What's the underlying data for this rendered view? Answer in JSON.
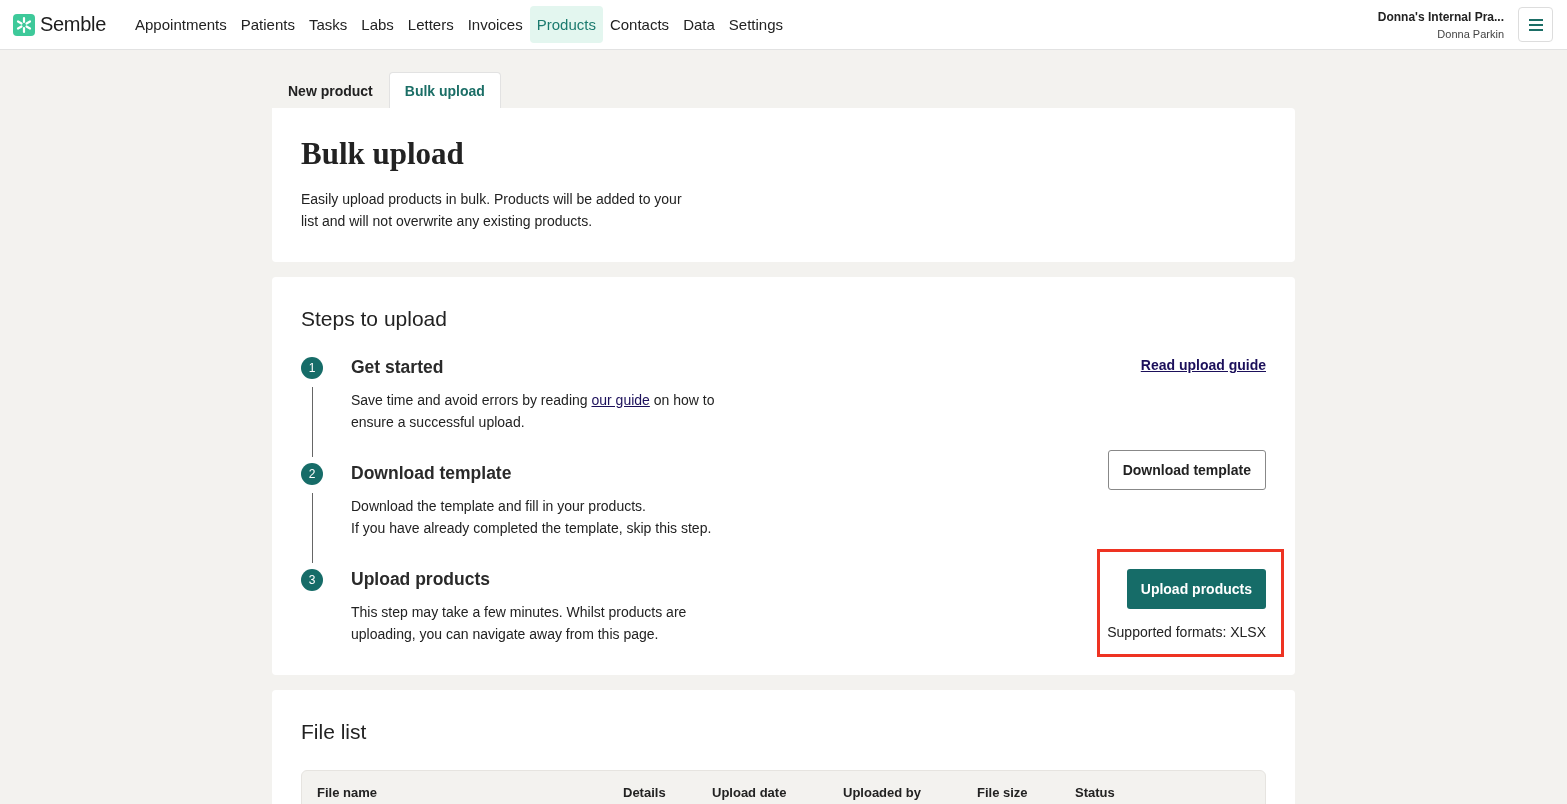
{
  "app": {
    "brand": "Semble"
  },
  "nav": [
    {
      "label": "Appointments",
      "selected": false
    },
    {
      "label": "Patients",
      "selected": false
    },
    {
      "label": "Tasks",
      "selected": false
    },
    {
      "label": "Labs",
      "selected": false
    },
    {
      "label": "Letters",
      "selected": false
    },
    {
      "label": "Invoices",
      "selected": false
    },
    {
      "label": "Products",
      "selected": true
    },
    {
      "label": "Contacts",
      "selected": false
    },
    {
      "label": "Data",
      "selected": false
    },
    {
      "label": "Settings",
      "selected": false
    }
  ],
  "account": {
    "practice": "Donna's Internal Pra...",
    "user": "Donna Parkin"
  },
  "tabs": [
    {
      "label": "New product",
      "selected": false
    },
    {
      "label": "Bulk upload",
      "selected": true
    }
  ],
  "intro": {
    "title": "Bulk upload",
    "text": "Easily upload products in bulk. Products will be added to your list and will not overwrite any existing products."
  },
  "steps_section": {
    "title": "Steps to upload",
    "steps": [
      {
        "number": "1",
        "title": "Get started",
        "text_before": "Save time and avoid errors by reading",
        "link": "our guide",
        "text_after": "on how to ensure a successful upload.",
        "action": {
          "kind": "link",
          "label": "Read upload guide"
        }
      },
      {
        "number": "2",
        "title": "Download template",
        "lines": [
          "Download the template and fill in your products.",
          "If you have already completed the template, skip this step."
        ],
        "action": {
          "kind": "outline",
          "label": "Download template"
        }
      },
      {
        "number": "3",
        "title": "Upload products",
        "lines": [
          "This step may take a few minutes. Whilst products are uploading, you can navigate away from this page."
        ],
        "action": {
          "kind": "primary",
          "label": "Upload products",
          "note": "Supported formats: XLSX",
          "highlighted": true
        }
      }
    ]
  },
  "file_list": {
    "title": "File list",
    "columns": [
      "File name",
      "Details",
      "Upload date",
      "Uploaded by",
      "File size",
      "Status"
    ]
  }
}
